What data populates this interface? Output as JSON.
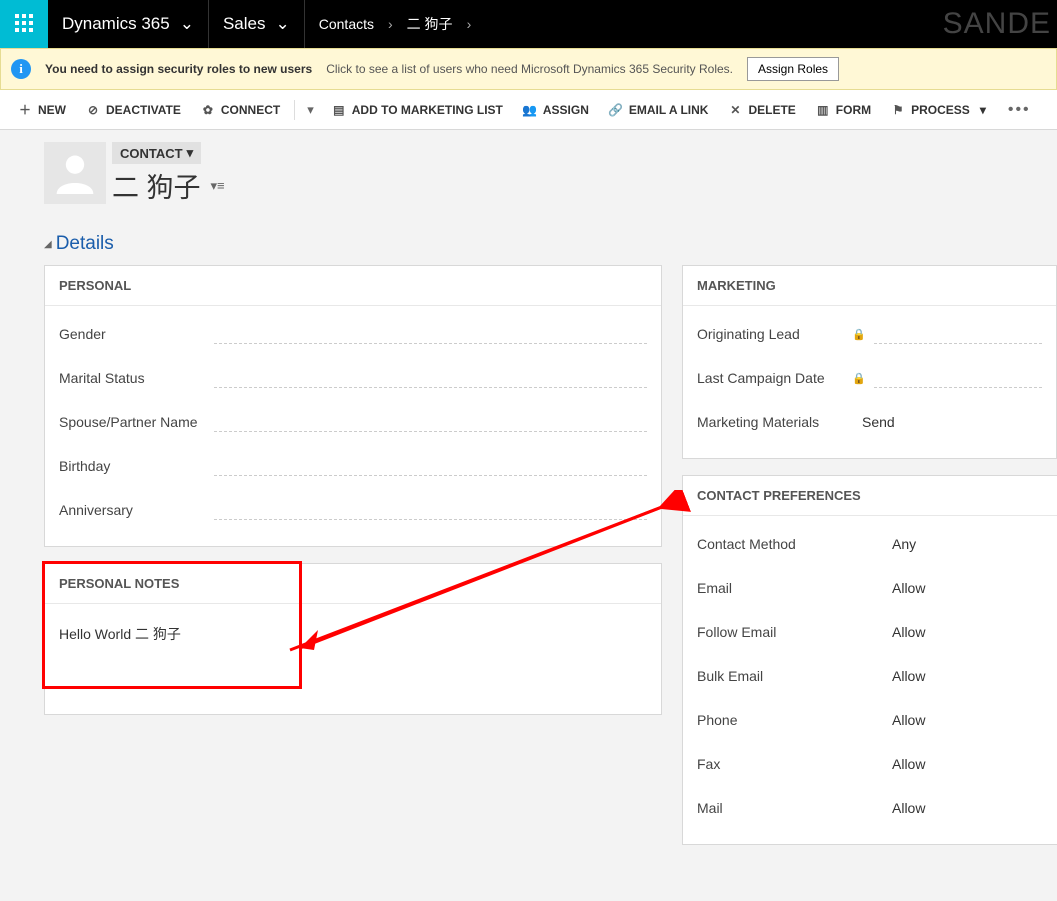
{
  "topbar": {
    "app": "Dynamics 365",
    "area": "Sales",
    "breadcrumb1": "Contacts",
    "breadcrumb2": "二 狗子",
    "watermark": "SANDE"
  },
  "notice": {
    "bold": "You need to assign security roles to new users",
    "sub": "Click to see a list of users who need Microsoft Dynamics 365 Security Roles.",
    "button": "Assign Roles"
  },
  "commands": {
    "new": "NEW",
    "deactivate": "DEACTIVATE",
    "connect": "CONNECT",
    "addlist": "ADD TO MARKETING LIST",
    "assign": "ASSIGN",
    "emaillink": "EMAIL A LINK",
    "delete": "DELETE",
    "form": "FORM",
    "process": "PROCESS"
  },
  "record": {
    "type": "CONTACT",
    "name": "二 狗子"
  },
  "section": {
    "details": "Details"
  },
  "panels": {
    "personal": {
      "title": "PERSONAL",
      "fields": {
        "gender": "Gender",
        "marital": "Marital Status",
        "spouse": "Spouse/Partner Name",
        "birthday": "Birthday",
        "anniversary": "Anniversary"
      }
    },
    "notes": {
      "title": "PERSONAL NOTES",
      "text": "Hello World 二 狗子"
    },
    "marketing": {
      "title": "MARKETING",
      "fields": {
        "origlead": "Originating Lead",
        "lastcamp": "Last Campaign Date",
        "materials": "Marketing Materials",
        "materials_val": "Send"
      }
    },
    "prefs": {
      "title": "CONTACT PREFERENCES",
      "rows": [
        {
          "label": "Contact Method",
          "value": "Any"
        },
        {
          "label": "Email",
          "value": "Allow"
        },
        {
          "label": "Follow Email",
          "value": "Allow"
        },
        {
          "label": "Bulk Email",
          "value": "Allow"
        },
        {
          "label": "Phone",
          "value": "Allow"
        },
        {
          "label": "Fax",
          "value": "Allow"
        },
        {
          "label": "Mail",
          "value": "Allow"
        }
      ]
    }
  }
}
